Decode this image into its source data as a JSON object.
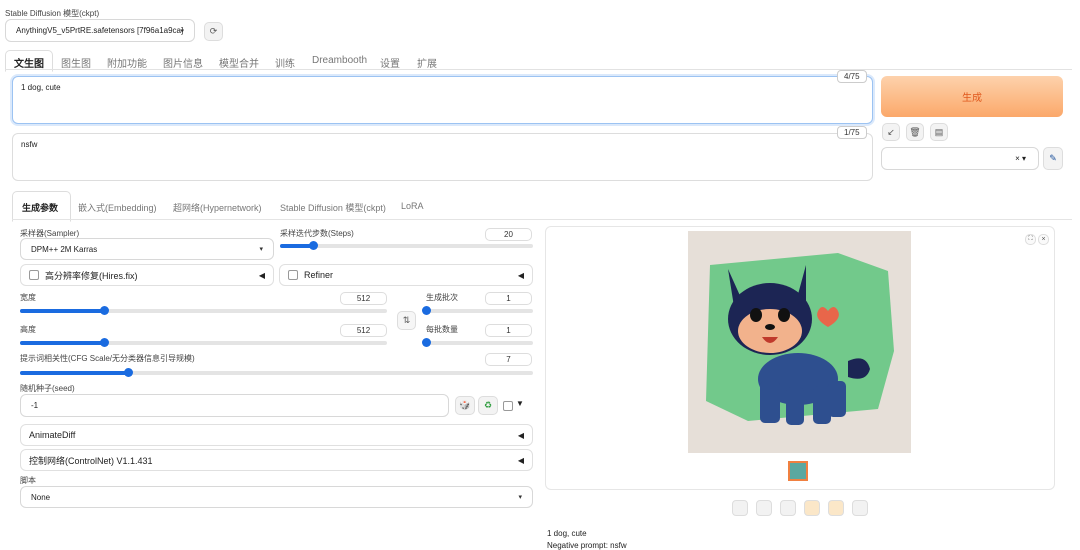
{
  "model": {
    "label": "Stable Diffusion 模型(ckpt)",
    "value": "AnythingV5_v5PrtRE.safetensors [7f96a1a9ca]"
  },
  "tabs": [
    "文生图",
    "图生图",
    "附加功能",
    "图片信息",
    "模型合并",
    "训练",
    "Dreambooth",
    "设置",
    "扩展"
  ],
  "prompt": {
    "text": "1 dog, cute",
    "counter": "4/75"
  },
  "negative": {
    "text": "nsfw",
    "counter": "1/75"
  },
  "generate_label": "生成",
  "style_close": "× ▾",
  "subtabs": [
    "生成参数",
    "嵌入式(Embedding)",
    "超网络(Hypernetwork)",
    "Stable Diffusion 模型(ckpt)",
    "LoRA"
  ],
  "sampler": {
    "label": "采样器(Sampler)",
    "value": "DPM++ 2M Karras"
  },
  "steps": {
    "label": "采样迭代步数(Steps)",
    "value": "20",
    "fraction": 0.13
  },
  "hires_label": "高分辨率修复(Hires.fix)",
  "refiner_label": "Refiner",
  "width": {
    "label": "宽度",
    "value": "512",
    "fraction": 0.23
  },
  "height": {
    "label": "高度",
    "value": "512",
    "fraction": 0.23
  },
  "batch_count": {
    "label": "生成批次",
    "value": "1",
    "fraction": 0.0
  },
  "batch_size": {
    "label": "每批数量",
    "value": "1",
    "fraction": 0.0
  },
  "swap_icon": "⇅",
  "cfg": {
    "label": "提示词相关性(CFG Scale/无分类器信息引导规模)",
    "value": "7",
    "fraction": 0.21
  },
  "seed": {
    "label": "随机种子(seed)",
    "value": "-1"
  },
  "animatediff_label": "AnimateDiff",
  "controlnet_label": "控制网络(ControlNet) V1.1.431",
  "script": {
    "label": "脚本",
    "value": "None"
  },
  "output_info": {
    "line1": "1 dog, cute",
    "line2": "Negative prompt: nsfw"
  },
  "colors": {
    "accent": "#1a6be0",
    "generate_bg": "#fcb173",
    "generate_text": "#e0581c"
  }
}
